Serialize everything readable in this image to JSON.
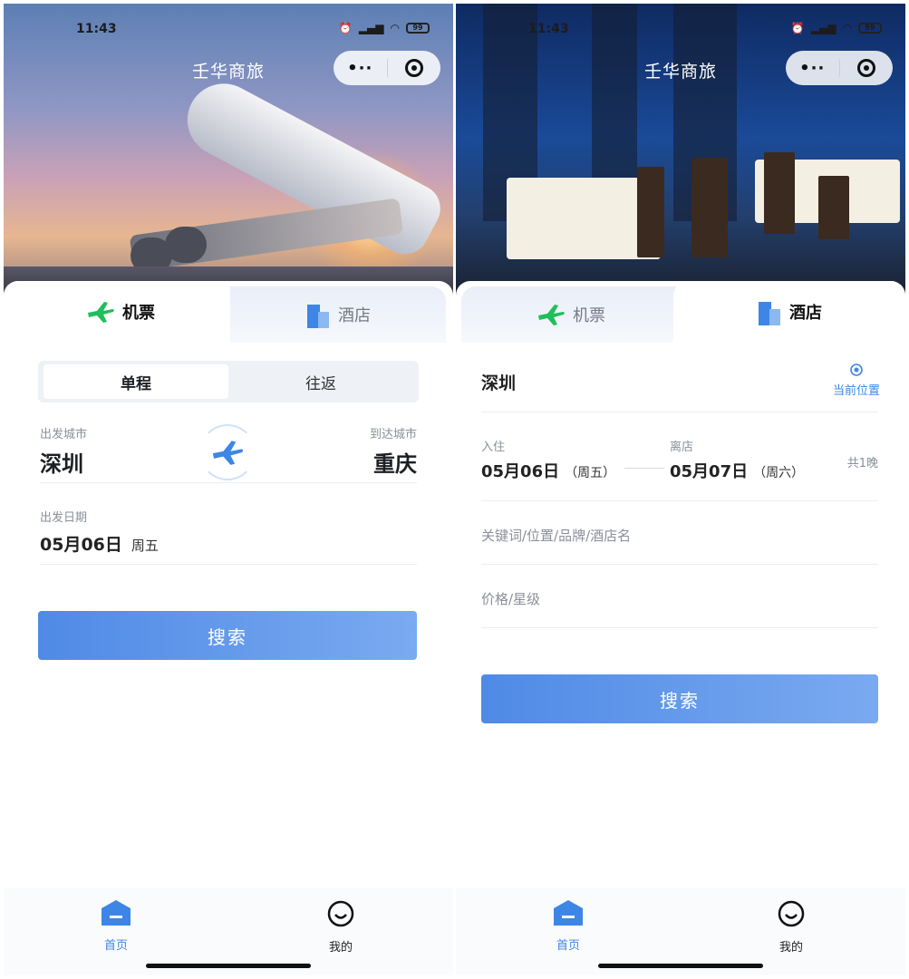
{
  "status_bar": {
    "time": "11:43",
    "battery": "99",
    "signal": "..ıll",
    "wifi": "≋"
  },
  "app": {
    "title": "壬华商旅",
    "more": "•··",
    "close_label": ""
  },
  "tabs": {
    "flight": "机票",
    "hotel": "酒店"
  },
  "flight": {
    "trip_types": [
      "单程",
      "往返"
    ],
    "depart_city_label": "出发城市",
    "depart_city": "深圳",
    "arrive_city_label": "到达城市",
    "arrive_city": "重庆",
    "date_label": "出发日期",
    "date": "05月06日",
    "weekday": "周五",
    "search": "搜索"
  },
  "hotel": {
    "city": "深圳",
    "current_location": "当前位置",
    "checkin_label": "入住",
    "checkin_date": "05月06日",
    "checkin_weekday": "（周五）",
    "checkout_label": "离店",
    "checkout_date": "05月07日",
    "checkout_weekday": "（周六）",
    "nights": "共1晚",
    "keyword_placeholder": "关键词/位置/品牌/酒店名",
    "price_placeholder": "价格/星级",
    "search": "搜索"
  },
  "tabbar": {
    "home": "首页",
    "mine": "我的"
  },
  "colors": {
    "accent": "#4f8ae6",
    "flight_green": "#1fbf5b",
    "hotel_blue": "#3d86e6"
  }
}
